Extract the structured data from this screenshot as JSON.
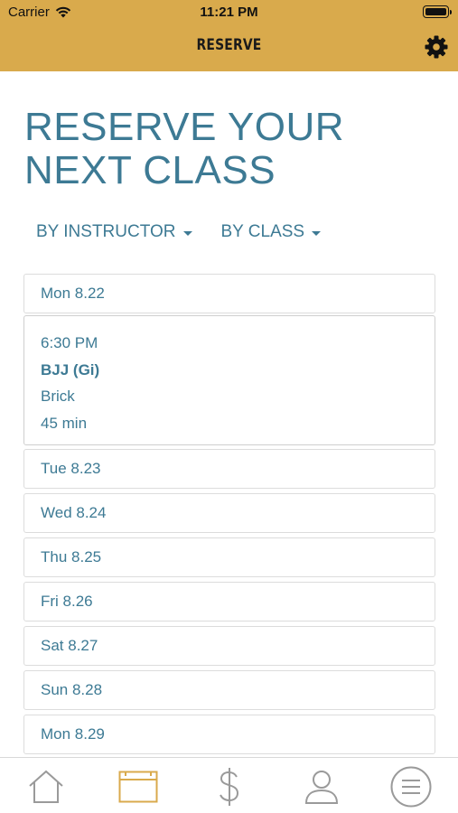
{
  "status": {
    "carrier": "Carrier",
    "time": "11:21 PM"
  },
  "header": {
    "title": "RESERVE",
    "accent_color": "#d9aa4c"
  },
  "page": {
    "title_line1": "RESERVE YOUR",
    "title_line2": "NEXT CLASS"
  },
  "filters": {
    "by_instructor": "BY INSTRUCTOR",
    "by_class": "BY CLASS"
  },
  "days": [
    {
      "label": "Mon 8.22"
    },
    {
      "label": "Tue 8.23"
    },
    {
      "label": "Wed 8.24"
    },
    {
      "label": "Thu 8.25"
    },
    {
      "label": "Fri 8.26"
    },
    {
      "label": "Sat 8.27"
    },
    {
      "label": "Sun 8.28"
    },
    {
      "label": "Mon 8.29"
    }
  ],
  "class": {
    "time": "6:30 PM",
    "name": "BJJ (Gi)",
    "instructor": "Brick",
    "duration": "45 min"
  },
  "tabbar": {
    "items": [
      {
        "icon": "home-icon",
        "active": false
      },
      {
        "icon": "calendar-icon",
        "active": true
      },
      {
        "icon": "dollar-icon",
        "active": false
      },
      {
        "icon": "profile-icon",
        "active": false
      },
      {
        "icon": "menu-icon",
        "active": false
      }
    ]
  }
}
